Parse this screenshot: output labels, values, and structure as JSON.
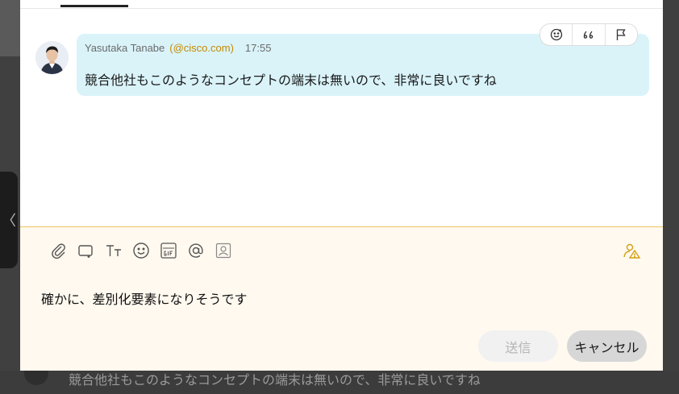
{
  "background": {
    "message_text": "競合他社もこのようなコンセプトの端末は無いので、非常に良いですね",
    "collapse_glyph": "〈"
  },
  "message": {
    "author": "Yasutaka Tanabe",
    "email": "(@cisco.com)",
    "time": "17:55",
    "text": "競合他社もこのようなコンセプトの端末は無いので、非常に良いですね",
    "actions": [
      "smiley-icon",
      "quote-icon",
      "flag-icon"
    ]
  },
  "composer": {
    "toolbar_icons": [
      "paperclip-icon",
      "add-whiteboard-icon",
      "text-format-icon",
      "emoji-icon",
      "gif-icon",
      "mention-icon",
      "contact-card-icon"
    ],
    "text": "確かに、差別化要素になりそうです",
    "send_label": "送信",
    "cancel_label": "キャンセル"
  },
  "colors": {
    "bubble": "#d9f3f9",
    "composer_bg": "#fff9ef",
    "accent": "#f0c35a",
    "email": "#c58a00"
  }
}
